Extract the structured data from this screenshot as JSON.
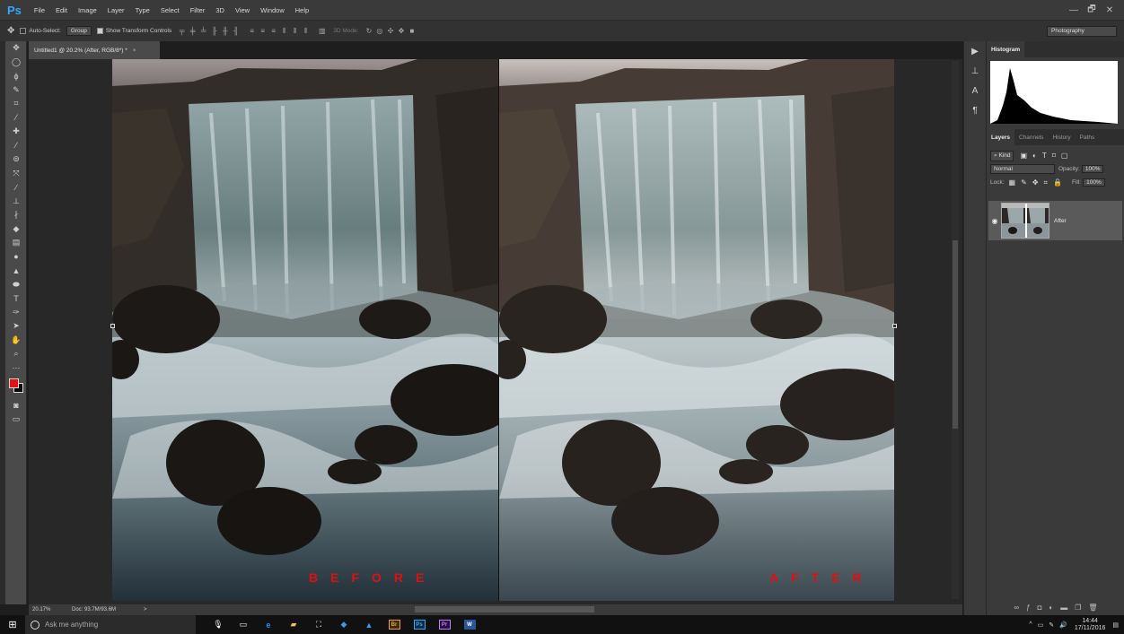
{
  "app": {
    "logo": "Ps"
  },
  "menu": [
    "File",
    "Edit",
    "Image",
    "Layer",
    "Type",
    "Select",
    "Filter",
    "3D",
    "View",
    "Window",
    "Help"
  ],
  "window_controls": [
    "—",
    "🗗",
    "✕"
  ],
  "options": {
    "auto_select_label": "Auto-Select:",
    "group_value": "Group",
    "show_transform_label": "Show Transform Controls",
    "mode_3d_label": "3D Mode:",
    "workspace": "Photography"
  },
  "document": {
    "tab_title": "Untitled1 @ 20.2% (After, RGB/8*) *",
    "close": "×",
    "before_label": "BEFORE",
    "after_label": "AFTER"
  },
  "status": {
    "zoom": "20.17%",
    "doc": "Doc: 93.7M/93.6M",
    "arrow": ">"
  },
  "panels": {
    "histogram_tab": "Histogram",
    "tabs": [
      "Layers",
      "Channels",
      "History",
      "Paths"
    ],
    "kind_label": "Kind",
    "blend_mode": "Normal",
    "opacity_label": "Opacity:",
    "opacity_value": "100%",
    "lock_label": "Lock:",
    "fill_label": "Fill:",
    "fill_value": "100%",
    "layer_name": "After"
  },
  "taskbar": {
    "search_placeholder": "Ask me anything",
    "time": "14:44",
    "date": "17/11/2016"
  },
  "colors": {
    "foreground": "#e81010",
    "background": "#000000",
    "ps_accent": "#31a8ff",
    "label_red": "#e01010"
  }
}
